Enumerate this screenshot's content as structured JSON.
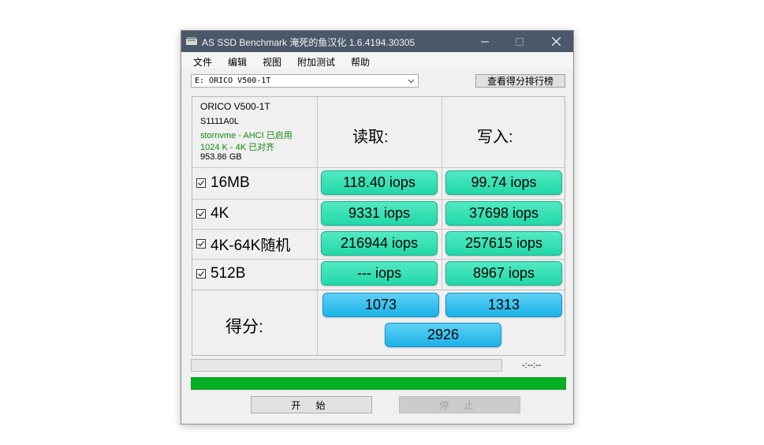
{
  "window": {
    "title": "AS SSD Benchmark 淹死的鱼汉化 1.6.4194.30305"
  },
  "menu": [
    "文件",
    "编辑",
    "视图",
    "附加测试",
    "帮助"
  ],
  "drive_select": {
    "value": "E: ORICO V500-1T"
  },
  "rank_button": "查看得分排行榜",
  "drive_info": {
    "model": "ORICO V500-1T",
    "firmware": "S1111A0L",
    "driver": "stornvme - AHCI 已启用",
    "alignment": "1024 K - 4K 已对齐",
    "capacity": "953.86 GB"
  },
  "columns": {
    "read": "读取:",
    "write": "写入:"
  },
  "tests": [
    {
      "label": "16MB",
      "checked": true,
      "read": "118.40 iops",
      "write": "99.74 iops"
    },
    {
      "label": "4K",
      "checked": true,
      "read": "9331 iops",
      "write": "37698 iops"
    },
    {
      "label": "4K-64K随机",
      "checked": true,
      "read": "216944 iops",
      "write": "257615 iops"
    },
    {
      "label": "512B",
      "checked": true,
      "read": "--- iops",
      "write": "8967 iops"
    }
  ],
  "score": {
    "label": "得分:",
    "read": "1073",
    "write": "1313",
    "total": "2926"
  },
  "progress": {
    "time": "-:--:--",
    "current_fraction": 0,
    "total_fraction": 1
  },
  "buttons": {
    "start": "开 始",
    "stop": "停 止"
  },
  "colors": {
    "result_cell": "#2ee0b2",
    "score_cell": "#2bbdf0",
    "total_progress": "#06b025",
    "titlebar": "#4a5869"
  }
}
